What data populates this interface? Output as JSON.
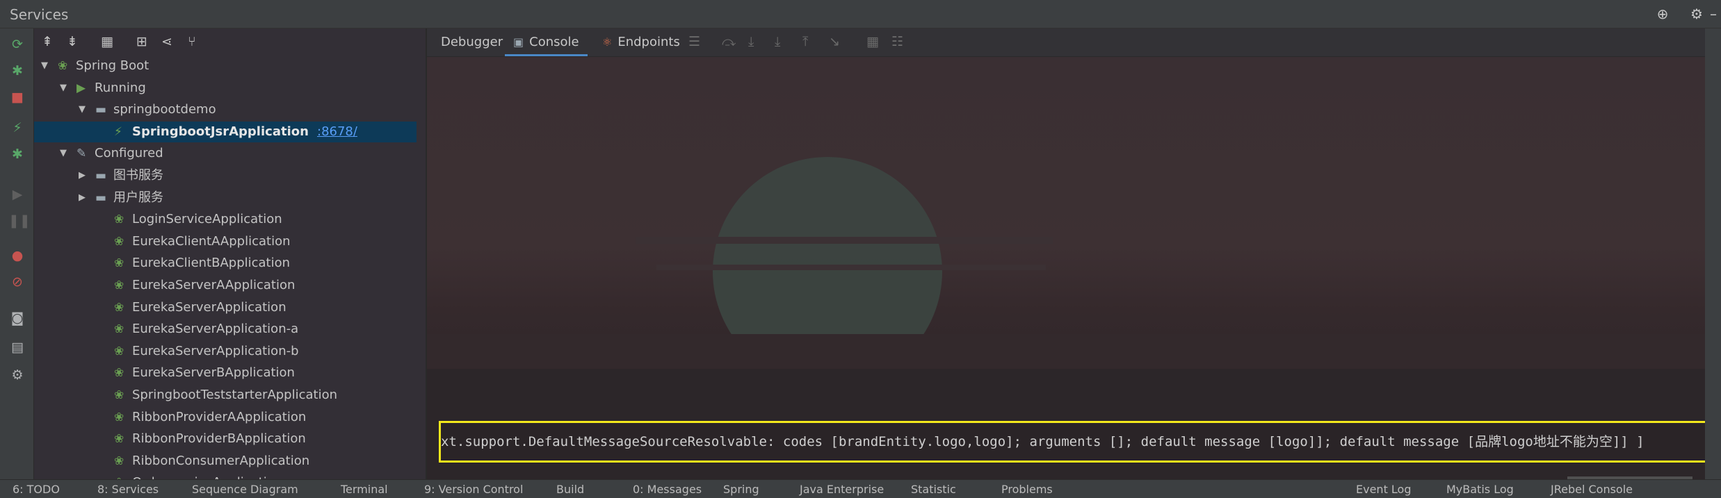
{
  "window": {
    "title": "Services"
  },
  "titlebar_icons": [
    "globe-icon",
    "gear-icon",
    "minimize-icon"
  ],
  "action_icons": [
    {
      "name": "rerun-icon",
      "glyph": "⟳",
      "color": "#59a869"
    },
    {
      "name": "debug-icon",
      "glyph": "✱",
      "color": "#59a869"
    },
    {
      "name": "stop-icon",
      "glyph": "■",
      "color": "#c75450"
    },
    {
      "name": "run-spring-icon",
      "glyph": "⚡",
      "color": "#59a869"
    },
    {
      "name": "debug-spring-icon",
      "glyph": "✱",
      "color": "#59a869"
    },
    {
      "name": "resume-icon",
      "glyph": "▶",
      "color": "#5f5f5f"
    },
    {
      "name": "pause-icon",
      "glyph": "❚❚",
      "color": "#5f5f5f"
    },
    {
      "name": "breakpoints-icon",
      "glyph": "●",
      "color": "#c75450"
    },
    {
      "name": "mute-breakpoints-icon",
      "glyph": "⊘",
      "color": "#c75450"
    },
    {
      "name": "camera-icon",
      "glyph": "◙",
      "color": "#afb1b3"
    },
    {
      "name": "layout-icon",
      "glyph": "▤",
      "color": "#afb1b3"
    },
    {
      "name": "settings-icon",
      "glyph": "⚙",
      "color": "#afb1b3"
    }
  ],
  "tree_toolbar_icons": [
    "expand-all-icon",
    "collapse-all-icon",
    "group-by-icon",
    "add-service-icon",
    "split-icon",
    "filter-icon"
  ],
  "tree": [
    {
      "label": "Spring Boot",
      "level": 0,
      "arrow": "▼",
      "icon": "spring"
    },
    {
      "label": "Running",
      "level": 1,
      "arrow": "▼",
      "icon": "run"
    },
    {
      "label": "springbootdemo",
      "level": 2,
      "arrow": "▼",
      "icon": "folder"
    },
    {
      "label": "SpringbootJsrApplication",
      "port": ":8678/",
      "level": 3,
      "arrow": "",
      "icon": "spring-run",
      "selected": true
    },
    {
      "label": "Configured",
      "level": 1,
      "arrow": "▼",
      "icon": "wrench"
    },
    {
      "label": "图书服务",
      "level": 2,
      "arrow": "▶",
      "icon": "folder"
    },
    {
      "label": "用户服务",
      "level": 2,
      "arrow": "▶",
      "icon": "folder"
    },
    {
      "label": "LoginServiceApplication",
      "level": 3,
      "arrow": "",
      "icon": "spring"
    },
    {
      "label": "EurekaClientAApplication",
      "level": 3,
      "arrow": "",
      "icon": "spring"
    },
    {
      "label": "EurekaClientBApplication",
      "level": 3,
      "arrow": "",
      "icon": "spring"
    },
    {
      "label": "EurekaServerAApplication",
      "level": 3,
      "arrow": "",
      "icon": "spring"
    },
    {
      "label": "EurekaServerApplication",
      "level": 3,
      "arrow": "",
      "icon": "spring"
    },
    {
      "label": "EurekaServerApplication-a",
      "level": 3,
      "arrow": "",
      "icon": "spring"
    },
    {
      "label": "EurekaServerApplication-b",
      "level": 3,
      "arrow": "",
      "icon": "spring"
    },
    {
      "label": "EurekaServerBApplication",
      "level": 3,
      "arrow": "",
      "icon": "spring"
    },
    {
      "label": "SpringbootTeststarterApplication",
      "level": 3,
      "arrow": "",
      "icon": "spring"
    },
    {
      "label": "RibbonProviderAApplication",
      "level": 3,
      "arrow": "",
      "icon": "spring"
    },
    {
      "label": "RibbonProviderBApplication",
      "level": 3,
      "arrow": "",
      "icon": "spring"
    },
    {
      "label": "RibbonConsumerApplication",
      "level": 3,
      "arrow": "",
      "icon": "spring"
    },
    {
      "label": "OrderserviceApplication",
      "level": 3,
      "arrow": "",
      "icon": "spring"
    }
  ],
  "tabs": [
    {
      "label": "Debugger",
      "icon": "",
      "active": false
    },
    {
      "label": "Console",
      "icon": "▣",
      "active": true
    },
    {
      "label": "Endpoints",
      "icon": "⚛",
      "active": false
    }
  ],
  "tab_toolbar_icons": [
    "threads-icon",
    "step-over-icon",
    "step-into-icon",
    "force-step-into-icon",
    "step-out-icon",
    "run-to-cursor-icon",
    "evaluate-icon",
    "trace-icon"
  ],
  "console": {
    "highlighted_line": "xt.support.DefaultMessageSourceResolvable: codes [brandEntity.logo,logo]; arguments []; default message [logo]]; default message [品牌logo地址不能为空]] ]"
  },
  "bottom_bar": [
    "6: TODO",
    "8: Services",
    "Sequence Diagram",
    "Terminal",
    "9: Version Control",
    "Build",
    "0: Messages",
    "Spring",
    "Java Enterprise",
    "Statistic",
    "Problems",
    "Event Log",
    "MyBatis Log",
    "JRebel Console"
  ]
}
